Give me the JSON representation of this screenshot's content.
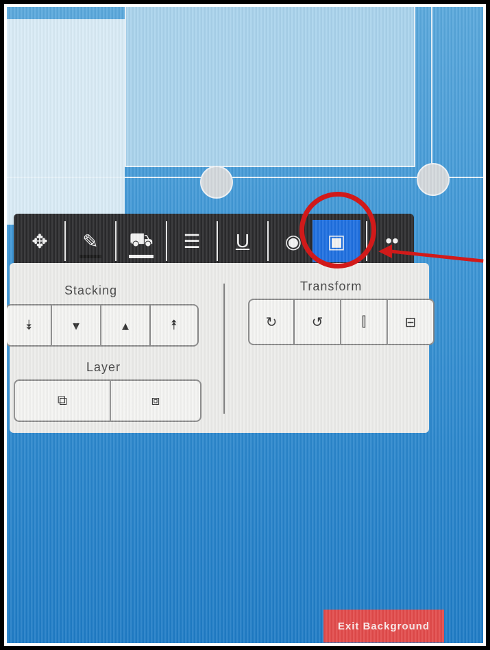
{
  "toolbar": {
    "buttons": [
      {
        "name": "move-icon",
        "glyph": "✥"
      },
      {
        "name": "pencil-icon",
        "glyph": "✎"
      },
      {
        "name": "fill-bucket-icon",
        "glyph": "⛟"
      },
      {
        "name": "line-style-icon",
        "glyph": "☰"
      },
      {
        "name": "underline-icon",
        "glyph": "U"
      },
      {
        "name": "eye-icon",
        "glyph": "◉"
      },
      {
        "name": "arrange-icon",
        "glyph": "▣"
      },
      {
        "name": "more-icon",
        "glyph": "••"
      }
    ],
    "active_color": "#1e6fe0"
  },
  "panel": {
    "stacking_title": "Stacking",
    "layer_title": "Layer",
    "transform_title": "Transform",
    "stacking_buttons": [
      {
        "name": "send-to-back-icon",
        "glyph": "⯯"
      },
      {
        "name": "send-backward-icon",
        "glyph": "▾"
      },
      {
        "name": "bring-forward-icon",
        "glyph": "▴"
      },
      {
        "name": "bring-to-front-icon",
        "glyph": "⯭"
      }
    ],
    "layer_buttons": [
      {
        "name": "layer-back-icon",
        "glyph": "⧉"
      },
      {
        "name": "layer-front-icon",
        "glyph": "⧈"
      }
    ],
    "transform_buttons": [
      {
        "name": "rotate-clockwise-icon",
        "glyph": "↻"
      },
      {
        "name": "rotate-counterclockwise-icon",
        "glyph": "↺"
      },
      {
        "name": "flip-horizontal-icon",
        "glyph": "⫿"
      },
      {
        "name": "flip-vertical-icon",
        "glyph": "⊟"
      }
    ]
  },
  "exit_button": "Exit Background",
  "colors": {
    "annotation_red": "#d11a1a",
    "exit_red": "#e24a4a"
  }
}
